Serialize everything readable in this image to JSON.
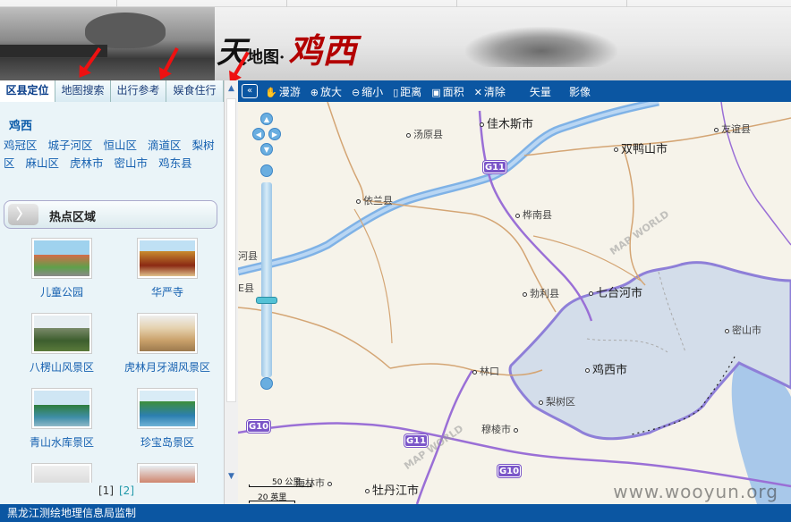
{
  "header": {
    "logo_text_1": "天",
    "logo_text_2": "地图·",
    "logo_text_3": "鸡西"
  },
  "left_panel": {
    "tabs": [
      {
        "label": "区县定位",
        "active": true
      },
      {
        "label": "地图搜索",
        "active": false
      },
      {
        "label": "出行参考",
        "active": false
      },
      {
        "label": "娱食住行",
        "active": false
      }
    ],
    "region_title": "鸡西",
    "districts": [
      "鸡冠区",
      "城子河区",
      "恒山区",
      "滴道区",
      "梨树区",
      "麻山区",
      "虎林市",
      "密山市",
      "鸡东县"
    ],
    "hot_header": "热点区域",
    "pois": [
      {
        "label": "儿童公园"
      },
      {
        "label": "华严寺"
      },
      {
        "label": "八楞山风景区"
      },
      {
        "label": "虎林月牙湖风景区"
      },
      {
        "label": "青山水库景区"
      },
      {
        "label": "珍宝岛景区"
      },
      {
        "label": ""
      },
      {
        "label": ""
      }
    ],
    "pager": {
      "page1": "[1]",
      "page2": "[2]"
    }
  },
  "toolbar": {
    "collapse_icon": "«",
    "tools": [
      {
        "label": "漫游",
        "icon": "hand-icon",
        "glyph": "✋"
      },
      {
        "label": "放大",
        "icon": "zoom-in-icon",
        "glyph": "⊕"
      },
      {
        "label": "缩小",
        "icon": "zoom-out-icon",
        "glyph": "⊖"
      },
      {
        "label": "距离",
        "icon": "ruler-icon",
        "glyph": "▯"
      },
      {
        "label": "面积",
        "icon": "area-icon",
        "glyph": "▣"
      },
      {
        "label": "清除",
        "icon": "clear-icon",
        "glyph": "✕"
      }
    ],
    "layers": [
      "矢量",
      "影像"
    ]
  },
  "map": {
    "places": {
      "jiamusi": "佳木斯市",
      "tangyuan": "汤原县",
      "youyi": "友谊县",
      "shuangyashan": "双鸭山市",
      "yilan": "依兰县",
      "huanan": "桦南县",
      "boli": "勃利县",
      "qitaihe": "七台河市",
      "mishan": "密山市",
      "jixi": "鸡西市",
      "lishu": "梨树区",
      "linkou": "林口",
      "muling": "穆棱市",
      "hailin": "海林市",
      "mudanjiang": "牡丹江市",
      "he_county": "河县",
      "e_county": "E县"
    },
    "shields": [
      "G11",
      "G10",
      "G11",
      "G10"
    ],
    "scale": {
      "top": "50 公里",
      "bottom": "20 英里"
    },
    "mapworld_marks": [
      "MAP WORLD",
      "MAP WORLD"
    ],
    "watermark": "www.wooyun.org"
  },
  "footer": {
    "text": "黑龙江测绘地理信息局监制"
  },
  "colors": {
    "toolbar": "#0b56a2",
    "road_major": "#9a6fd6",
    "river": "#7fb2e6",
    "highlight_region": "#c8d6ea",
    "link": "#1560b0"
  }
}
